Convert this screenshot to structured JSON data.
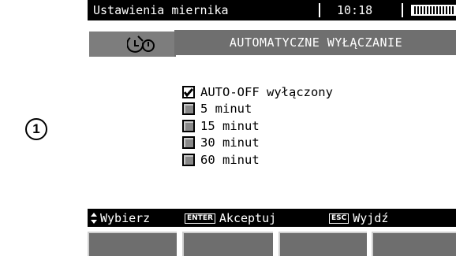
{
  "step_marker": "1",
  "statusbar": {
    "title": "Ustawienia miernika",
    "time": "10:18",
    "battery_icon": "battery-icon"
  },
  "header": {
    "title": "AUTOMATYCZNE WYŁĄCZANIE",
    "icon": "auto-off-timer-icon"
  },
  "options": [
    {
      "label": "AUTO-OFF wyłączony",
      "checked": true
    },
    {
      "label": "5 minut",
      "checked": false
    },
    {
      "label": "15 minut",
      "checked": false
    },
    {
      "label": "30 minut",
      "checked": false
    },
    {
      "label": "60 minut",
      "checked": false
    }
  ],
  "footer": {
    "select_label": "Wybierz",
    "enter_key": "ENTER",
    "accept_label": "Akceptuj",
    "esc_key": "ESC",
    "exit_label": "Wyjdź"
  },
  "colors": {
    "bar_bg": "#000000",
    "header_bg": "#6f6f6f",
    "fkey_bg": "#6e6e6e"
  }
}
